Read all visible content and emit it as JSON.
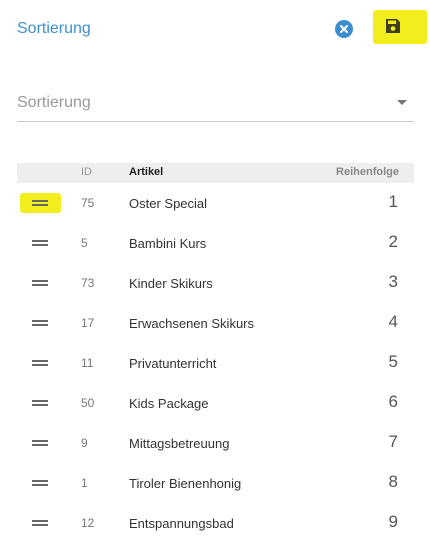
{
  "header": {
    "title": "Sortierung"
  },
  "select": {
    "placeholder": "Sortierung"
  },
  "table": {
    "columns": {
      "id": "ID",
      "artikel": "Artikel",
      "reihenfolge": "Reihenfolge"
    },
    "rows": [
      {
        "id": "75",
        "name": "Oster Special",
        "order": "1"
      },
      {
        "id": "5",
        "name": "Bambini Kurs",
        "order": "2"
      },
      {
        "id": "73",
        "name": "Kinder Skikurs",
        "order": "3"
      },
      {
        "id": "17",
        "name": "Erwachsenen Skikurs",
        "order": "4"
      },
      {
        "id": "11",
        "name": "Privatunterricht",
        "order": "5"
      },
      {
        "id": "50",
        "name": "Kids Package",
        "order": "6"
      },
      {
        "id": "9",
        "name": "Mittagsbetreuung",
        "order": "7"
      },
      {
        "id": "1",
        "name": "Tiroler Bienenhonig",
        "order": "8"
      },
      {
        "id": "12",
        "name": "Entspannungsbad",
        "order": "9"
      }
    ]
  },
  "icons": {
    "close": "close-circle-icon",
    "save": "floppy-disk-icon",
    "handle": "drag-handle-icon",
    "dropdown": "chevron-down-icon"
  },
  "colors": {
    "accent": "#3d8fd1",
    "highlight": "#f2ed1c",
    "header_bg": "#eeeeee"
  }
}
